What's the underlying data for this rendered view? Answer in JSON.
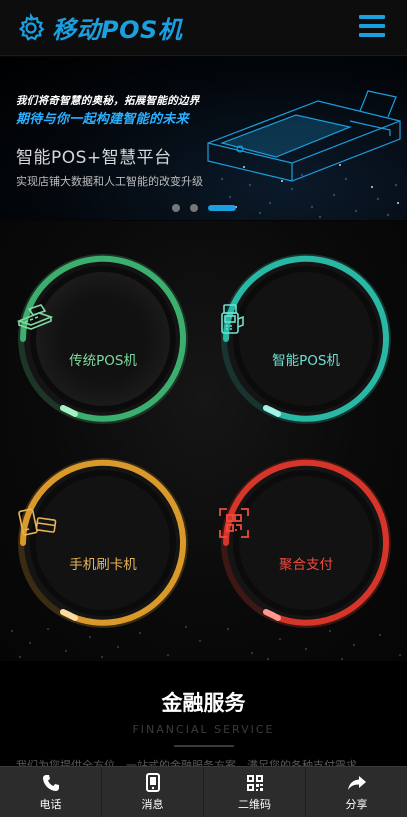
{
  "header": {
    "title": "移动POS机",
    "logo_icon": "gear-icon",
    "menu_icon": "hamburger-menu-icon",
    "accent_color": "#1a9fe0"
  },
  "banner": {
    "line1": "我们将奇智慧的奥秘，拓展智能的边界",
    "line2": "期待与你一起构建智能的未来",
    "title": "智能POS+智慧平台",
    "subtitle": "实现店铺大数据和人工智能的改变升级",
    "slides": [
      "slide-1",
      "slide-2",
      "slide-3"
    ],
    "active_slide": 3
  },
  "products": [
    {
      "label": "传统POS机",
      "icon": "card-terminal-icon",
      "color": "#4ec07a"
    },
    {
      "label": "智能POS机",
      "icon": "smart-pos-icon",
      "color": "#2fc4b2"
    },
    {
      "label": "手机刷卡机",
      "icon": "phone-card-icon",
      "color": "#e0a030"
    },
    {
      "label": "聚合支付",
      "icon": "qr-scan-icon",
      "color": "#e03a2e"
    }
  ],
  "financial": {
    "title": "金融服务",
    "subtitle_en": "FINANCIAL SERVICE",
    "body": "我们为您提供全方位、一站式的金融服务方案，满足您的各种支付需求"
  },
  "bottom_nav": [
    {
      "label": "电话",
      "icon": "phone-icon"
    },
    {
      "label": "消息",
      "icon": "message-icon"
    },
    {
      "label": "二维码",
      "icon": "qrcode-icon"
    },
    {
      "label": "分享",
      "icon": "share-icon"
    }
  ]
}
